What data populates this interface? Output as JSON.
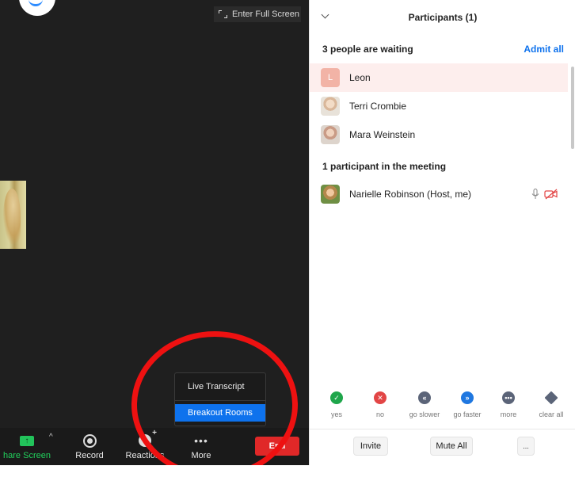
{
  "meeting": {
    "fullscreen_label": "Enter Full Screen",
    "more_menu": {
      "items": [
        {
          "label": "Live Transcript"
        },
        {
          "label": "Breakout Rooms"
        }
      ]
    },
    "toolbar": {
      "share_label": "hare Screen",
      "share_icon": "↑",
      "record_label": "Record",
      "reactions_label": "Reactions",
      "more_label": "More",
      "more_icon": "•••",
      "end_label": "End"
    }
  },
  "panel": {
    "title": "Participants (1)",
    "waiting": {
      "heading": "3 people are waiting",
      "admit_all": "Admit all",
      "people": [
        {
          "initial": "L",
          "name": "Leon"
        },
        {
          "name": "Terri Crombie"
        },
        {
          "name": "Mara Weinstein"
        }
      ]
    },
    "in_meeting": {
      "heading": "1 participant in the meeting",
      "people": [
        {
          "name": "Narielle Robinson (Host, me)"
        }
      ]
    },
    "feedback": [
      {
        "icon": "✓",
        "label": "yes"
      },
      {
        "icon": "✕",
        "label": "no"
      },
      {
        "icon": "«",
        "label": "go slower"
      },
      {
        "icon": "»",
        "label": "go faster"
      },
      {
        "icon": "•••",
        "label": "more"
      },
      {
        "icon": "",
        "label": "clear all"
      }
    ],
    "buttons": {
      "invite": "Invite",
      "mute_all": "Mute All",
      "more": "..."
    }
  },
  "colors": {
    "accent": "#0e72ed",
    "end_red": "#e02828",
    "share_green": "#22c35b",
    "annotation_red": "#ee1111",
    "waiting_highlight": "#fdeeed"
  }
}
